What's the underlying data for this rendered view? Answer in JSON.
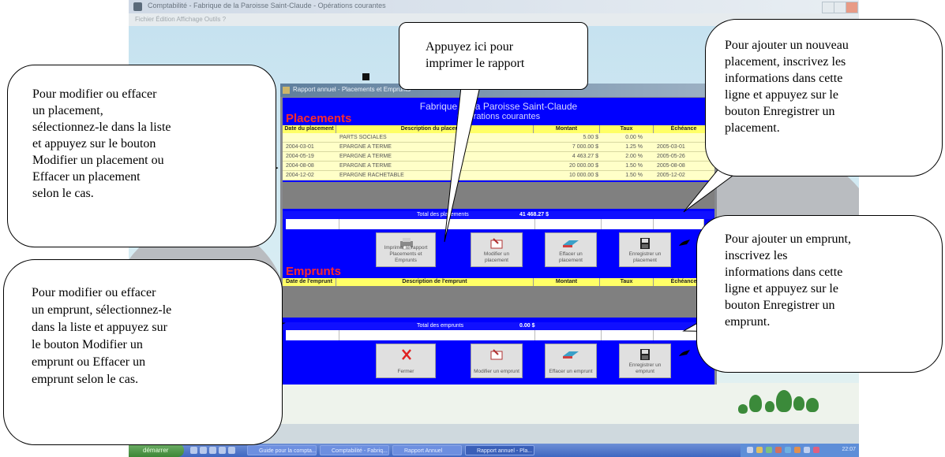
{
  "app": {
    "title": "Comptabilité - Fabrique de la Paroisse Saint-Claude - Opérations courantes",
    "menu": "Fichier   Édition   Affichage   Outils   ?"
  },
  "report": {
    "window_title": "Rapport annuel - Placements et Emprunts",
    "org_name": "Fabrique de la Paroisse Saint-Claude",
    "subtitle": "Opérations courantes",
    "placements": {
      "section_title": "Placements",
      "columns": [
        "Date du placement",
        "Description du placement",
        "Montant",
        "Taux",
        "Échéance"
      ],
      "rows": [
        {
          "date": "",
          "description": "PARTS SOCIALES",
          "amount": "5.00 $",
          "rate": "0.00 %",
          "due": ""
        },
        {
          "date": "2004-03-01",
          "description": "EPARGNE A TERME",
          "amount": "7 000.00 $",
          "rate": "1.25 %",
          "due": "2005-03-01"
        },
        {
          "date": "2004-05-19",
          "description": "EPARGNE A TERME",
          "amount": "4 463.27 $",
          "rate": "2.00 %",
          "due": "2005-05-26"
        },
        {
          "date": "2004-08-08",
          "description": "EPARGNE A TERME",
          "amount": "20 000.00 $",
          "rate": "1.50 %",
          "due": "2005-08-08"
        },
        {
          "date": "2004-12-02",
          "description": "EPARGNE RACHETABLE",
          "amount": "10 000.00 $",
          "rate": "1.50 %",
          "due": "2005-12-02"
        }
      ],
      "total_label": "Total des placements",
      "total_value": "41 468.27 $"
    },
    "emprunts": {
      "section_title": "Emprunts",
      "columns": [
        "Date de l'emprunt",
        "Description de l'emprunt",
        "Montant",
        "Taux",
        "Échéance"
      ],
      "total_label": "Total des emprunts",
      "total_value": "0.00 $"
    },
    "buttons": {
      "print": "Imprimer le rapport Placements et Emprunts",
      "modify_placement": "Modifier un placement",
      "delete_placement": "Effacer un placement",
      "save_placement": "Enregistrer un placement",
      "close": "Fermer",
      "modify_emprunt": "Modifier un emprunt",
      "delete_emprunt": "Effacer un emprunt",
      "save_emprunt": "Enregistrer un emprunt"
    }
  },
  "taskbar": {
    "start": "démarrer",
    "tasks": [
      "Guide pour la compta...",
      "Comptabilité - Fabriq...",
      "Rapport Annuel",
      "Rapport annuel - Pla..."
    ],
    "clock": "22:07"
  },
  "callouts": {
    "print": [
      "Appuyez ici pour",
      "imprimer le rapport"
    ],
    "add_placement": [
      "Pour ajouter un nouveau",
      "placement, inscrivez les",
      "informations dans cette",
      "ligne et appuyez sur le",
      "bouton Enregistrer un",
      "placement."
    ],
    "modify_placement": [
      "Pour modifier ou effacer",
      "un placement,",
      "sélectionnez-le dans la liste",
      "et appuyez sur le bouton",
      "Modifier un placement  ou",
      "Effacer un placement",
      "selon le cas."
    ],
    "add_emprunt": [
      "Pour ajouter un emprunt,",
      "inscrivez les",
      "informations dans cette",
      "ligne et appuyez sur le",
      "bouton Enregistrer un",
      "emprunt."
    ],
    "modify_emprunt": [
      "Pour modifier ou effacer",
      "un emprunt, sélectionnez-le",
      "dans la liste et appuyez sur",
      "le bouton Modifier un",
      "emprunt ou Effacer un",
      "emprunt selon le cas."
    ]
  },
  "colors": {
    "report_bg": "#0000ff",
    "section_title": "#ff2a2a",
    "grid_header": "#ffff66",
    "grid_row": "#ffffc8"
  }
}
